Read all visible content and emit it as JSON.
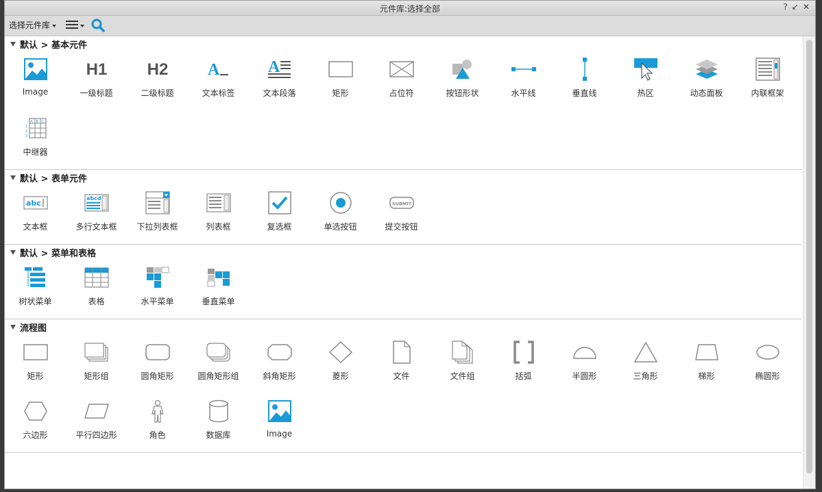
{
  "window": {
    "title": "元件库:选择全部",
    "help_glyph": "?",
    "collapse_glyph": "↙",
    "close_glyph": "✕"
  },
  "toolbar": {
    "library_select_label": "选择元件库",
    "menu_icon": "hamburger-menu-icon",
    "search_icon": "search-icon"
  },
  "colors": {
    "accent": "#1a9ad6",
    "icon_stroke": "#8a8a8a",
    "icon_dark": "#555555"
  },
  "sections": [
    {
      "title": "默认 > 基本元件",
      "items": [
        {
          "label": "Image",
          "icon": "image-icon"
        },
        {
          "label": "一级标题",
          "icon": "h1-icon"
        },
        {
          "label": "二级标题",
          "icon": "h2-icon"
        },
        {
          "label": "文本标签",
          "icon": "text-label-icon"
        },
        {
          "label": "文本段落",
          "icon": "text-paragraph-icon"
        },
        {
          "label": "矩形",
          "icon": "rectangle-icon"
        },
        {
          "label": "占位符",
          "icon": "placeholder-icon"
        },
        {
          "label": "按钮形状",
          "icon": "button-shape-icon"
        },
        {
          "label": "水平线",
          "icon": "horizontal-line-icon"
        },
        {
          "label": "垂直线",
          "icon": "vertical-line-icon"
        },
        {
          "label": "热区",
          "icon": "hotspot-icon"
        },
        {
          "label": "动态面板",
          "icon": "dynamic-panel-icon"
        },
        {
          "label": "内联框架",
          "icon": "inline-frame-icon"
        },
        {
          "label": "中继器",
          "icon": "repeater-icon"
        }
      ]
    },
    {
      "title": "默认 > 表单元件",
      "items": [
        {
          "label": "文本框",
          "icon": "text-field-icon"
        },
        {
          "label": "多行文本框",
          "icon": "text-area-icon"
        },
        {
          "label": "下拉列表框",
          "icon": "droplist-icon"
        },
        {
          "label": "列表框",
          "icon": "list-box-icon"
        },
        {
          "label": "复选框",
          "icon": "checkbox-icon"
        },
        {
          "label": "单选按钮",
          "icon": "radio-button-icon"
        },
        {
          "label": "提交按钮",
          "icon": "submit-button-icon"
        }
      ]
    },
    {
      "title": "默认 > 菜单和表格",
      "items": [
        {
          "label": "树状菜单",
          "icon": "tree-menu-icon"
        },
        {
          "label": "表格",
          "icon": "table-icon"
        },
        {
          "label": "水平菜单",
          "icon": "horizontal-menu-icon"
        },
        {
          "label": "垂直菜单",
          "icon": "vertical-menu-icon"
        }
      ]
    },
    {
      "title": "流程图",
      "items": [
        {
          "label": "矩形",
          "icon": "flow-rectangle-icon"
        },
        {
          "label": "矩形组",
          "icon": "flow-rectangle-group-icon"
        },
        {
          "label": "圆角矩形",
          "icon": "flow-rounded-rectangle-icon"
        },
        {
          "label": "圆角矩形组",
          "icon": "flow-rounded-rectangle-group-icon"
        },
        {
          "label": "斜角矩形",
          "icon": "flow-bevel-rectangle-icon"
        },
        {
          "label": "菱形",
          "icon": "flow-diamond-icon"
        },
        {
          "label": "文件",
          "icon": "flow-file-icon"
        },
        {
          "label": "文件组",
          "icon": "flow-file-group-icon"
        },
        {
          "label": "括弧",
          "icon": "flow-bracket-icon"
        },
        {
          "label": "半圆形",
          "icon": "flow-semicircle-icon"
        },
        {
          "label": "三角形",
          "icon": "flow-triangle-icon"
        },
        {
          "label": "梯形",
          "icon": "flow-trapezoid-icon"
        },
        {
          "label": "椭圆形",
          "icon": "flow-ellipse-icon"
        },
        {
          "label": "六边形",
          "icon": "flow-hexagon-icon"
        },
        {
          "label": "平行四边形",
          "icon": "flow-parallelogram-icon"
        },
        {
          "label": "角色",
          "icon": "flow-actor-icon"
        },
        {
          "label": "数据库",
          "icon": "flow-database-icon"
        },
        {
          "label": "Image",
          "icon": "image-icon"
        }
      ]
    }
  ]
}
